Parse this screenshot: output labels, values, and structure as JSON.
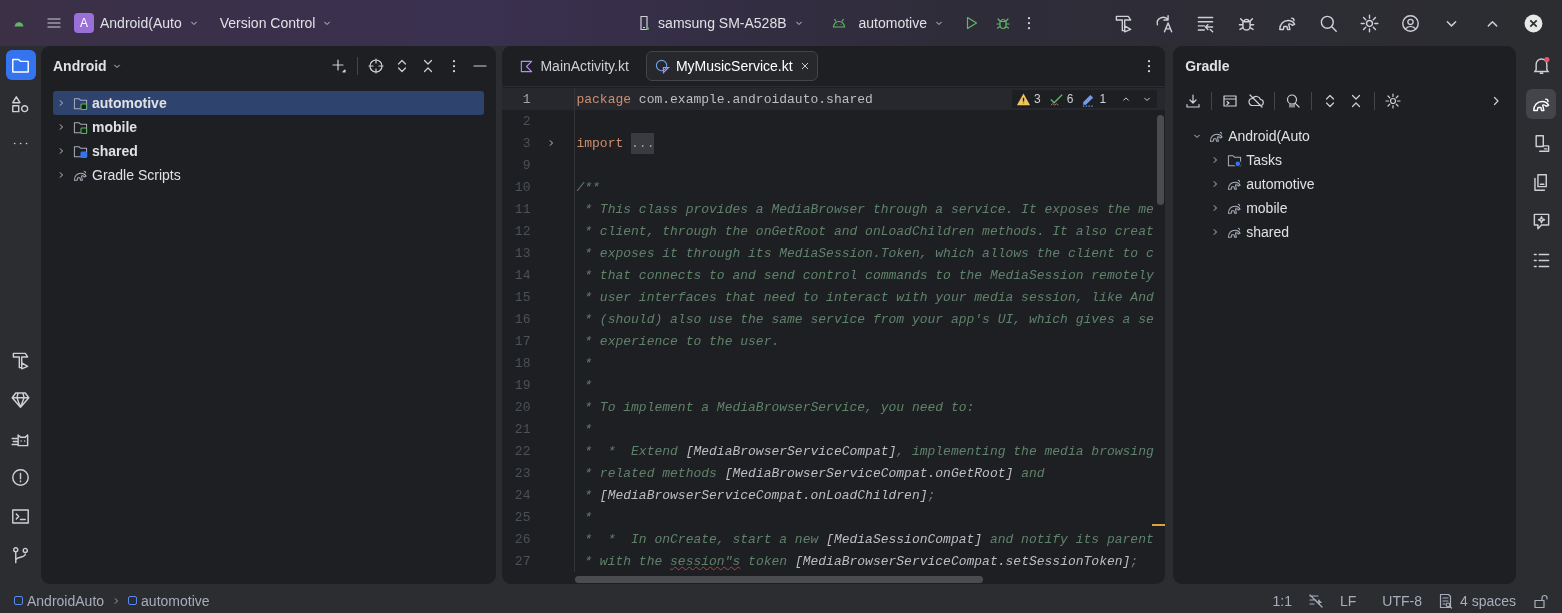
{
  "title_bar": {
    "project": {
      "badge": "A",
      "label": "Android(Auto"
    },
    "vcs": "Version Control",
    "device": "samsung SM-A528B",
    "run_config": "automotive"
  },
  "project_panel": {
    "title": "Android",
    "tree": [
      {
        "label": "automotive",
        "kind": "module",
        "selected": true,
        "expanded": false
      },
      {
        "label": "mobile",
        "kind": "module",
        "selected": false,
        "expanded": false
      },
      {
        "label": "shared",
        "kind": "library",
        "selected": false,
        "expanded": false
      },
      {
        "label": "Gradle Scripts",
        "kind": "gradle",
        "selected": false,
        "expanded": false
      }
    ]
  },
  "editor": {
    "tabs": [
      {
        "label": "MainActivity.kt",
        "kind": "kotlin",
        "selected": false
      },
      {
        "label": "MyMusicService.kt",
        "kind": "service",
        "selected": true
      }
    ],
    "inspections": {
      "warnings": "3",
      "typos": "6",
      "hints": "1"
    },
    "lines": [
      {
        "number": "1",
        "current": true,
        "foldable": false,
        "segments": [
          {
            "kind": "keyword",
            "text": "package"
          },
          {
            "kind": "plain",
            "text": " com.example.androidauto.shared"
          }
        ]
      },
      {
        "number": "2",
        "current": false,
        "foldable": false
      },
      {
        "number": "3",
        "current": false,
        "foldable": true,
        "segments": [
          {
            "kind": "keyword",
            "text": "import"
          },
          {
            "kind": "folded",
            "text": "..."
          }
        ]
      },
      {
        "number": "9",
        "current": false,
        "foldable": false
      },
      {
        "number": "10",
        "current": false,
        "foldable": false,
        "segments": [
          {
            "kind": "comment",
            "text": "/**"
          }
        ]
      },
      {
        "number": "11",
        "current": false,
        "foldable": false,
        "segments": [
          {
            "kind": "comment",
            "text": " * This class provides a MediaBrowser through a service. It exposes the me"
          }
        ]
      },
      {
        "number": "12",
        "current": false,
        "foldable": false,
        "segments": [
          {
            "kind": "comment",
            "text": " * client, through the onGetRoot and onLoadChildren methods. It also creat"
          }
        ]
      },
      {
        "number": "13",
        "current": false,
        "foldable": false,
        "segments": [
          {
            "kind": "comment",
            "text": " * exposes it through its MediaSession.Token, which allows the client to c"
          }
        ]
      },
      {
        "number": "14",
        "current": false,
        "foldable": false,
        "segments": [
          {
            "kind": "comment",
            "text": " * that connects to and send control commands to the MediaSession remotely"
          }
        ]
      },
      {
        "number": "15",
        "current": false,
        "foldable": false,
        "segments": [
          {
            "kind": "comment",
            "text": " * user interfaces that need to interact with your media session, like And"
          }
        ]
      },
      {
        "number": "16",
        "current": false,
        "foldable": false,
        "segments": [
          {
            "kind": "comment",
            "text": " * (should) also use the same service from your app's UI, which gives a se"
          }
        ]
      },
      {
        "number": "17",
        "current": false,
        "foldable": false,
        "segments": [
          {
            "kind": "comment",
            "text": " * experience to the user."
          }
        ]
      },
      {
        "number": "18",
        "current": false,
        "foldable": false,
        "segments": [
          {
            "kind": "comment",
            "text": " *"
          }
        ]
      },
      {
        "number": "19",
        "current": false,
        "foldable": false,
        "segments": [
          {
            "kind": "comment",
            "text": " *"
          }
        ]
      },
      {
        "number": "20",
        "current": false,
        "foldable": false,
        "segments": [
          {
            "kind": "comment",
            "text": " * To implement a MediaBrowserService, you need to:"
          }
        ]
      },
      {
        "number": "21",
        "current": false,
        "foldable": false,
        "segments": [
          {
            "kind": "comment",
            "text": " *"
          }
        ]
      },
      {
        "number": "22",
        "current": false,
        "foldable": false,
        "segments": [
          {
            "kind": "comment",
            "text": " *  *  Extend "
          },
          {
            "kind": "ref",
            "text": "[MediaBrowserServiceCompat]"
          },
          {
            "kind": "comment",
            "text": ", implementing the media browsing"
          }
        ]
      },
      {
        "number": "23",
        "current": false,
        "foldable": false,
        "segments": [
          {
            "kind": "comment",
            "text": " * related methods "
          },
          {
            "kind": "ref",
            "text": "[MediaBrowserServiceCompat.onGetRoot]"
          },
          {
            "kind": "comment",
            "text": " and"
          }
        ]
      },
      {
        "number": "24",
        "current": false,
        "foldable": false,
        "segments": [
          {
            "kind": "comment",
            "text": " * "
          },
          {
            "kind": "ref",
            "text": "[MediaBrowserServiceCompat.onLoadChildren]"
          },
          {
            "kind": "comment",
            "text": ";"
          }
        ]
      },
      {
        "number": "25",
        "current": false,
        "foldable": false,
        "segments": [
          {
            "kind": "comment",
            "text": " *"
          }
        ]
      },
      {
        "number": "26",
        "current": false,
        "foldable": false,
        "segments": [
          {
            "kind": "comment",
            "text": " *  *  In onCreate, start a new "
          },
          {
            "kind": "ref",
            "text": "[MediaSessionCompat]"
          },
          {
            "kind": "comment",
            "text": " and notify its parent"
          }
        ]
      },
      {
        "number": "27",
        "current": false,
        "foldable": false,
        "segments": [
          {
            "kind": "comment",
            "text": " * with the "
          },
          {
            "kind": "typo",
            "text": "session\"s"
          },
          {
            "kind": "comment",
            "text": " token "
          },
          {
            "kind": "ref",
            "text": "[MediaBrowserServiceCompat.setSessionToken]"
          },
          {
            "kind": "comment",
            "text": ";"
          }
        ]
      }
    ]
  },
  "gradle": {
    "title": "Gradle",
    "tree": [
      {
        "label": "Android(Auto",
        "kind": "project",
        "expanded": true,
        "children": [
          {
            "label": "Tasks",
            "kind": "tasks",
            "expanded": false
          },
          {
            "label": "automotive",
            "kind": "project",
            "expanded": false
          },
          {
            "label": "mobile",
            "kind": "project",
            "expanded": false
          },
          {
            "label": "shared",
            "kind": "project",
            "expanded": false
          }
        ]
      }
    ]
  },
  "notifications": {
    "unread": true
  },
  "status_bar": {
    "breadcrumbs": [
      "AndroidAuto",
      "automotive"
    ],
    "position": "1:1",
    "line_separator": "LF",
    "encoding": "UTF-8",
    "indent": "4 spaces"
  }
}
